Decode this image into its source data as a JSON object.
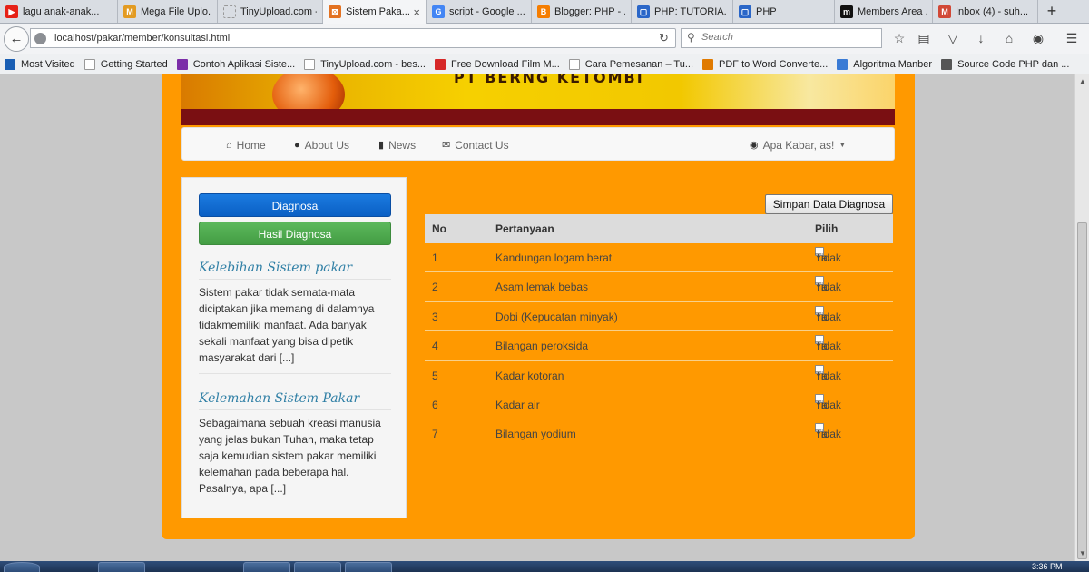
{
  "browser": {
    "tabs": [
      {
        "label": "lagu anak-anak...",
        "color": "#e62117",
        "fav": "▶"
      },
      {
        "label": "Mega File Uplo...",
        "color": "#e39b22",
        "fav": "M"
      },
      {
        "label": "TinyUpload.com - ...",
        "color": "",
        "fav": ""
      },
      {
        "label": "Sistem Paka...",
        "color": "#e37222",
        "fav": "⊠"
      },
      {
        "label": "script - Google ...",
        "color": "#4285f4",
        "fav": "G"
      },
      {
        "label": "Blogger: PHP - ...",
        "color": "#f57d00",
        "fav": "B"
      },
      {
        "label": "PHP: TUTORIA...",
        "color": "#2a66c8",
        "fav": "▢"
      },
      {
        "label": "PHP",
        "color": "#2a66c8",
        "fav": "▢"
      },
      {
        "label": "Members Area ...",
        "color": "#111111",
        "fav": "m"
      },
      {
        "label": "Inbox (4) - suh...",
        "color": "#d14836",
        "fav": "M"
      }
    ],
    "active_tab_index": 3,
    "url": "localhost/pakar/member/konsultasi.html",
    "search_placeholder": "Search",
    "bookmarks": [
      "Most Visited",
      "Getting Started",
      "Contoh Aplikasi Siste...",
      "TinyUpload.com - bes...",
      "Free Download Film M...",
      "Cara Pemesanan – Tu...",
      "PDF to Word Converte...",
      "Algoritma Manber",
      "Source Code PHP dan ..."
    ],
    "icons": {
      "back": "back-arrow-icon",
      "reload": "reload-icon",
      "search": "search-icon",
      "bookmark": "star-icon",
      "reading": "reading-list-icon",
      "pocket": "pocket-icon",
      "download": "download-icon",
      "home": "home-icon",
      "chat": "chat-icon",
      "menu": "hamburger-menu-icon"
    }
  },
  "site": {
    "banner_text": "PT BERNG KETOMBI",
    "nav": [
      {
        "label": "Home",
        "icon": "home-icon",
        "glyph": "⌂"
      },
      {
        "label": "About Us",
        "icon": "user-icon",
        "glyph": "👤"
      },
      {
        "label": "News",
        "icon": "book-icon",
        "glyph": "▮"
      },
      {
        "label": "Contact Us",
        "icon": "envelope-icon",
        "glyph": "✉"
      }
    ],
    "user_menu": "Apa Kabar, as!",
    "sidebar": {
      "btn_diagnosa": "Diagnosa",
      "btn_hasil": "Hasil Diagnosa",
      "section1_title": "Kelebihan Sistem pakar",
      "section1_text": "Sistem pakar tidak semata-mata diciptakan jika memang di dalamnya tidakmemiliki manfaat. Ada banyak sekali manfaat yang bisa dipetik masyarakat dari [...]",
      "section2_title": "Kelemahan Sistem Pakar",
      "section2_text": "Sebagaimana sebuah kreasi manusia yang jelas bukan Tuhan, maka tetap saja kemudian sistem pakar memiliki kelemahan pada beberapa hal. Pasalnya, apa [...]"
    },
    "save_button": "Simpan Data Diagnosa",
    "table": {
      "headers": {
        "no": "No",
        "question": "Pertanyaan",
        "choose": "Pilih"
      },
      "yes_label": "Ya",
      "no_label": "Tidak",
      "rows": [
        {
          "no": "1",
          "question": "Kandungan logam berat"
        },
        {
          "no": "2",
          "question": "Asam lemak bebas"
        },
        {
          "no": "3",
          "question": "Dobi (Kepucatan minyak)"
        },
        {
          "no": "4",
          "question": "Bilangan peroksida"
        },
        {
          "no": "5",
          "question": "Kadar kotoran"
        },
        {
          "no": "6",
          "question": "Kadar air"
        },
        {
          "no": "7",
          "question": "Bilangan yodium"
        }
      ]
    }
  },
  "taskbar": {
    "clock": "3:36 PM"
  }
}
